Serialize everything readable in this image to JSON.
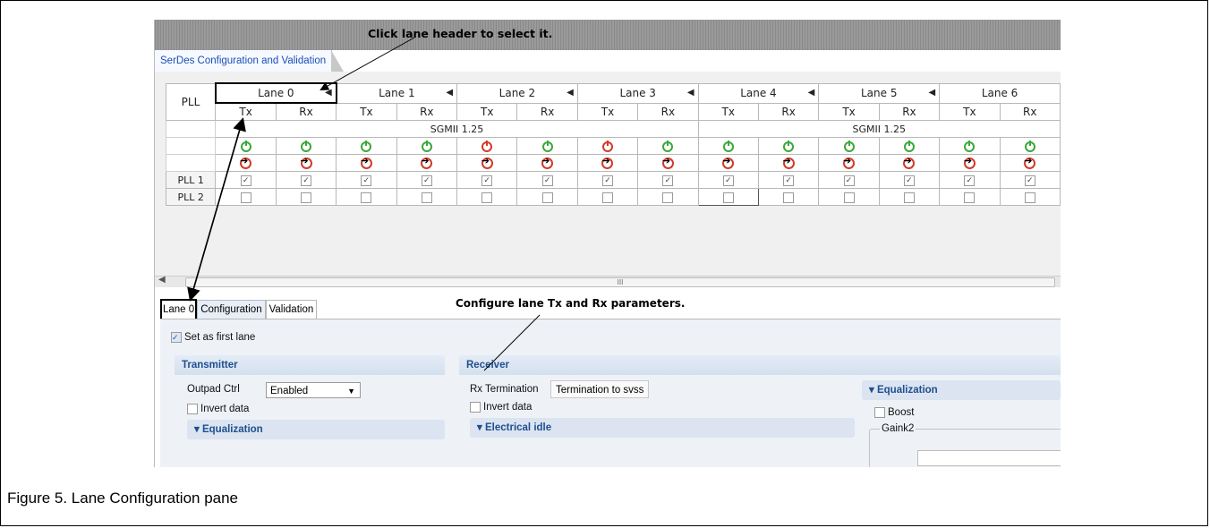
{
  "callouts": {
    "top": "Click lane header to select it.",
    "middle": "Configure lane Tx and Rx parameters."
  },
  "window_tab": "SerDes Configuration and Validation",
  "grid": {
    "pll_header": "PLL",
    "lanes": [
      "Lane 0",
      "Lane 1",
      "Lane 2",
      "Lane 3",
      "Lane 4",
      "Lane 5",
      "Lane 6"
    ],
    "tx_label": "Tx",
    "rx_label": "Rx",
    "protocol_left": "SGMII 1.25",
    "protocol_right": "SGMII 1.25",
    "pll_rows": [
      "PLL 1",
      "PLL 2"
    ],
    "power_status": [
      "green",
      "green",
      "green",
      "green",
      "red",
      "green",
      "red",
      "green",
      "green",
      "green",
      "green",
      "green",
      "green",
      "green"
    ],
    "status_colors": {
      "green": "#3aa83a",
      "red": "#d23a2a"
    },
    "scroll_mark": "III"
  },
  "lower_tabs": [
    "Lane 0",
    "Configuration",
    "Validation"
  ],
  "config": {
    "first_lane_label": "Set as first lane",
    "first_lane_checked": true,
    "transmitter": {
      "title": "Transmitter",
      "outpad_label": "Outpad Ctrl",
      "outpad_value": "Enabled",
      "invert_label": "Invert data",
      "equalization": "Equalization"
    },
    "receiver": {
      "title": "Receiver",
      "rx_term_label": "Rx Termination",
      "rx_term_value": "Termination to svss",
      "invert_label": "Invert data",
      "electrical_idle": "Electrical idle"
    },
    "right": {
      "equalization": "Equalization",
      "boost_label": "Boost",
      "gaink2_label": "Gaink2"
    }
  },
  "caption": "Figure 5.  Lane Configuration pane"
}
